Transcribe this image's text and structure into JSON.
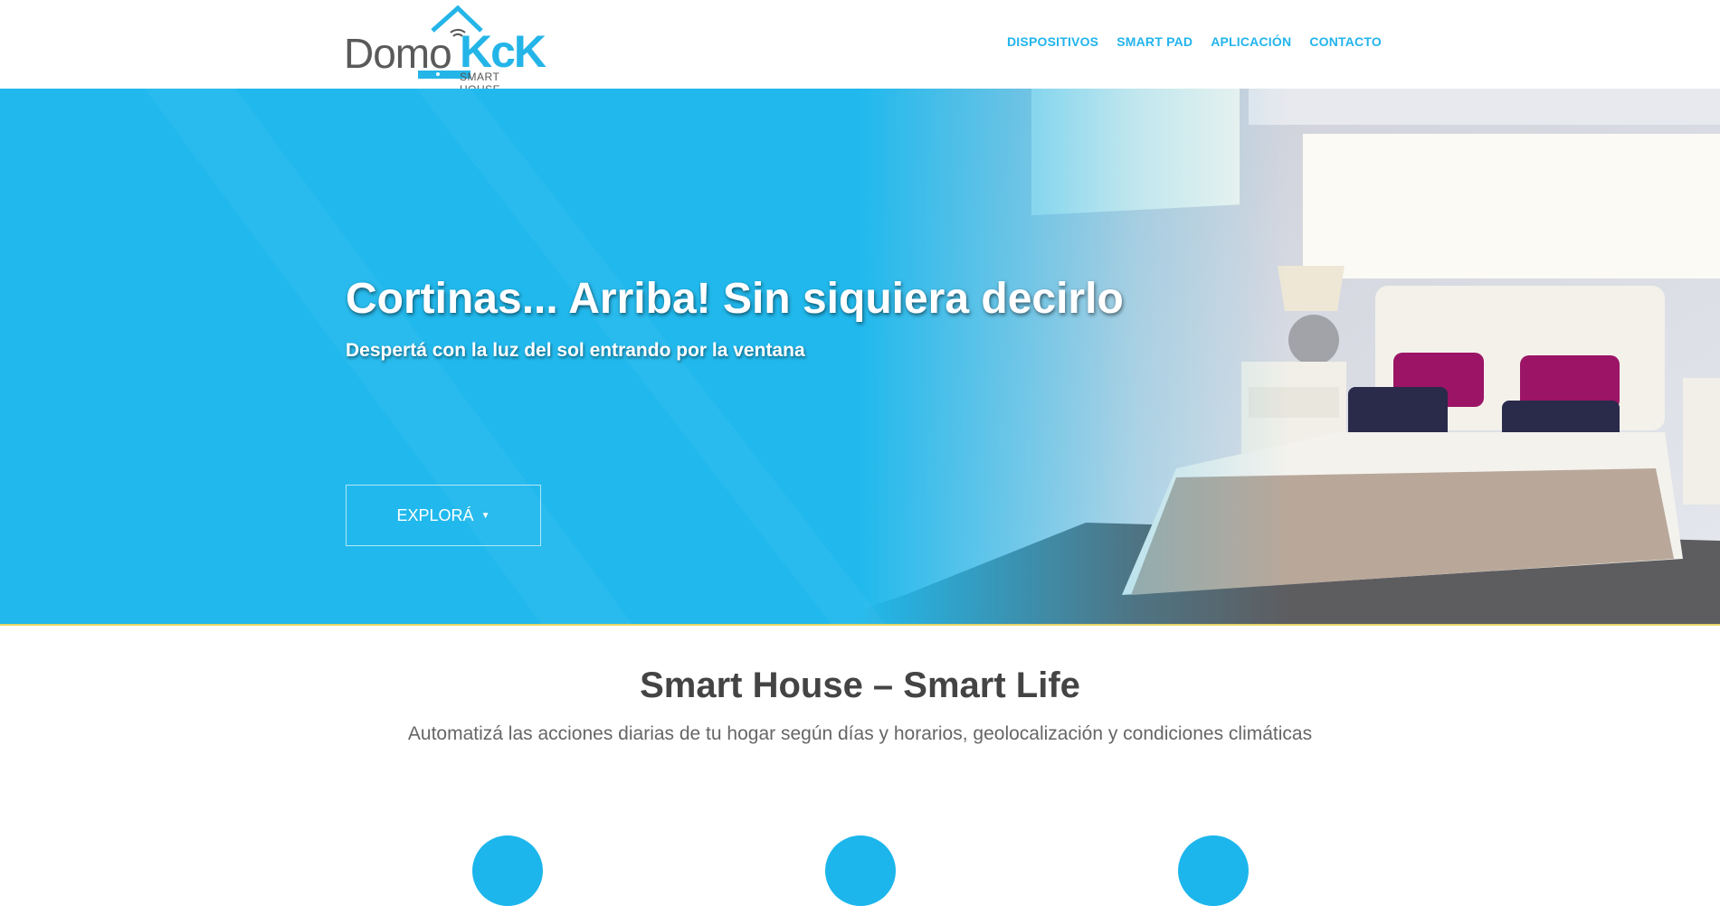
{
  "brand": {
    "name_part1": "Domo",
    "name_part2": "KcK",
    "tagline": "SMART HOUSE",
    "accent_color": "#24b5e8"
  },
  "nav": {
    "items": [
      {
        "label": "DISPOSITIVOS"
      },
      {
        "label": "SMART PAD"
      },
      {
        "label": "APLICACIÓN"
      },
      {
        "label": "CONTACTO"
      }
    ]
  },
  "hero": {
    "title": "Cortinas... Arriba! Sin siquiera decirlo",
    "subtitle": "Despertá con la luz del sol entrando por la ventana",
    "button_label": "EXPLORÁ",
    "button_icon": "caret-down-icon",
    "overlay_color": "#21b9ed"
  },
  "intro": {
    "title": "Smart House – Smart Life",
    "subtitle": "Automatizá las acciones diarias de tu hogar según días y horarios, geolocalización y condiciones climáticas"
  }
}
